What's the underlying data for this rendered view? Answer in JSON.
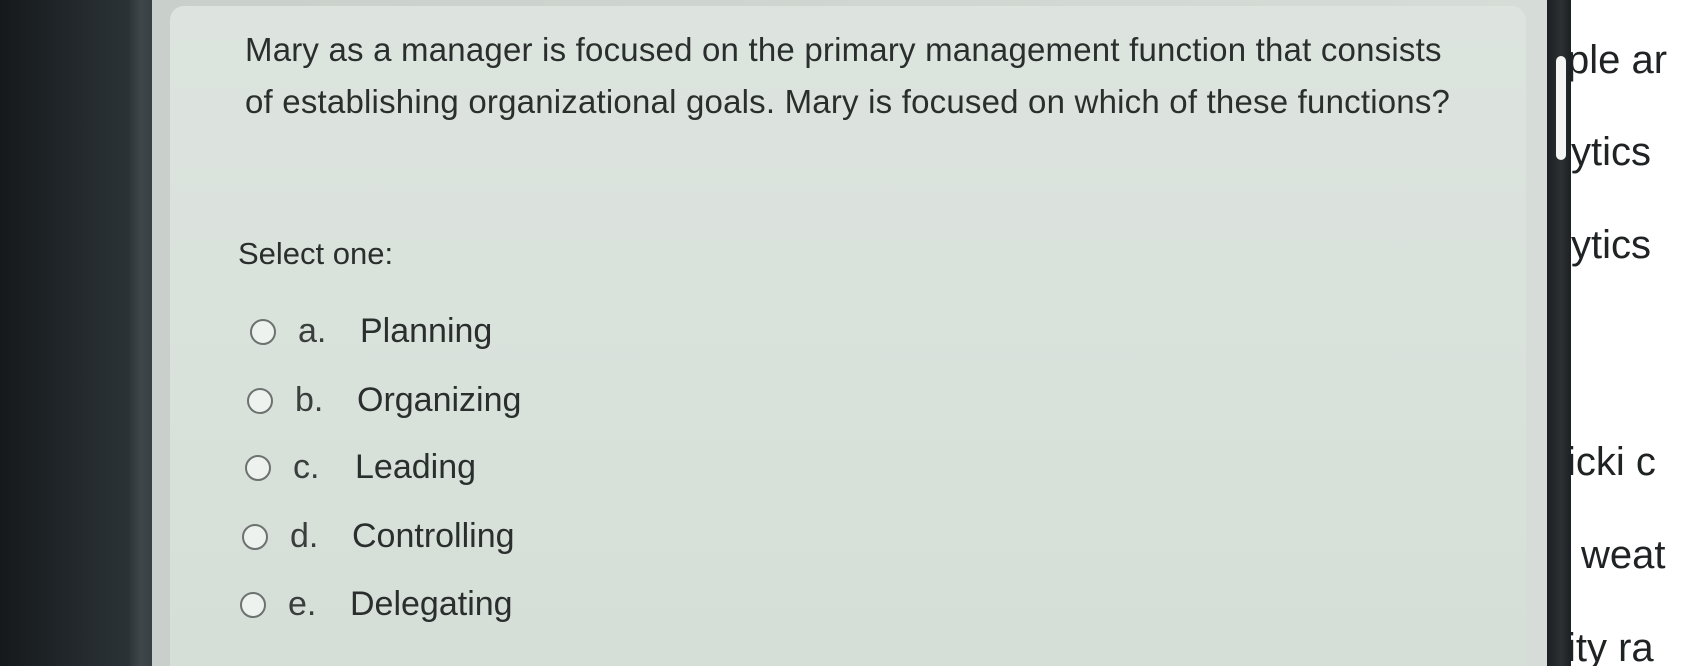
{
  "question": {
    "text": "Mary as a manager is focused on the primary management function that consists of establishing organizational goals. Mary is focused on which of these functions?",
    "prompt": "Select one:",
    "options": [
      {
        "letter": "a.",
        "label": "Planning"
      },
      {
        "letter": "b.",
        "label": "Organizing"
      },
      {
        "letter": "c.",
        "label": "Leading"
      },
      {
        "letter": "d.",
        "label": "Controlling"
      },
      {
        "letter": "e.",
        "label": "Delegating"
      }
    ]
  },
  "side_panel": {
    "fragments": [
      "ple ar",
      "ytics",
      "ytics",
      "icki c",
      "weat",
      "ity ra"
    ]
  }
}
